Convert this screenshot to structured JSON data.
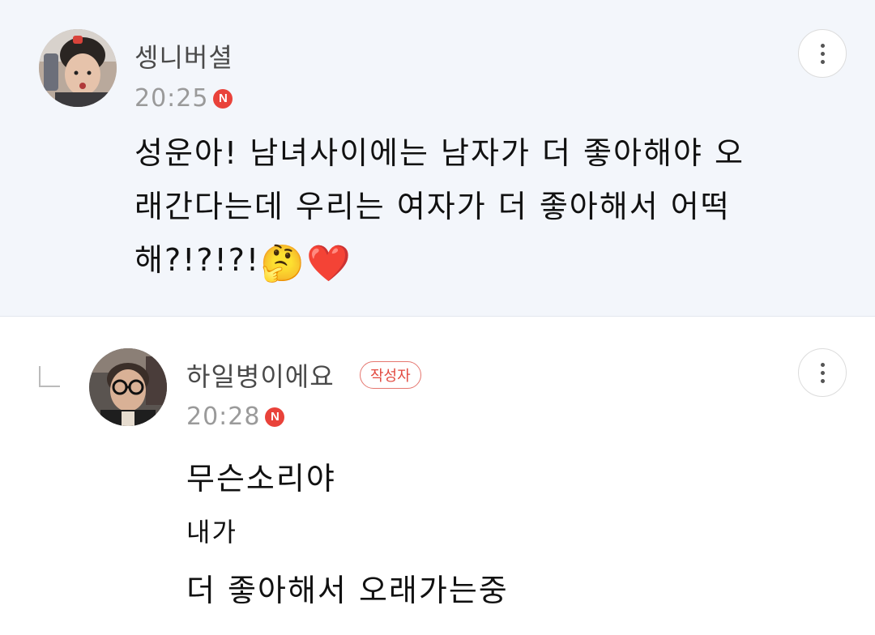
{
  "comment": {
    "author": "셍니버셜",
    "time": "20:25",
    "new_badge": "N",
    "text_lines": [
      "성운아! 남녀사이에는 남자가 더 좋아해야 오",
      "래간다는데 우리는 여자가 더 좋아해서 어떡",
      "해?!?!?!"
    ],
    "emojis": [
      "🤔",
      "❤️"
    ]
  },
  "reply": {
    "author": "하일병이에요",
    "author_badge": "작성자",
    "time": "20:28",
    "new_badge": "N",
    "lines": [
      "무슨소리야",
      "내가",
      "더 좋아해서 오래가는중"
    ]
  },
  "colors": {
    "highlight_bg": "#f3f6fb",
    "new_badge": "#e9423a",
    "author_badge": "#e24a40"
  },
  "icons": {
    "more": "more-vertical-icon",
    "reply": "reply-corner-icon"
  }
}
